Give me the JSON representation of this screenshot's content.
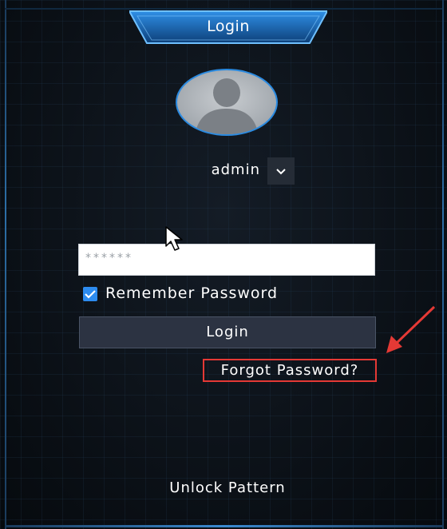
{
  "dialog": {
    "title": "Login"
  },
  "user": {
    "username": "admin",
    "dropdown_icon": "chevron-down-icon"
  },
  "password": {
    "value": "******"
  },
  "remember": {
    "label": "Remember Password",
    "checked": true
  },
  "actions": {
    "login_label": "Login",
    "forgot_label": "Forgot Password?",
    "unlock_pattern_label": "Unlock Pattern"
  },
  "annotation": {
    "highlight_color": "#e53935"
  },
  "colors": {
    "background": "#0a0f15",
    "accent": "#2d8cf0"
  }
}
